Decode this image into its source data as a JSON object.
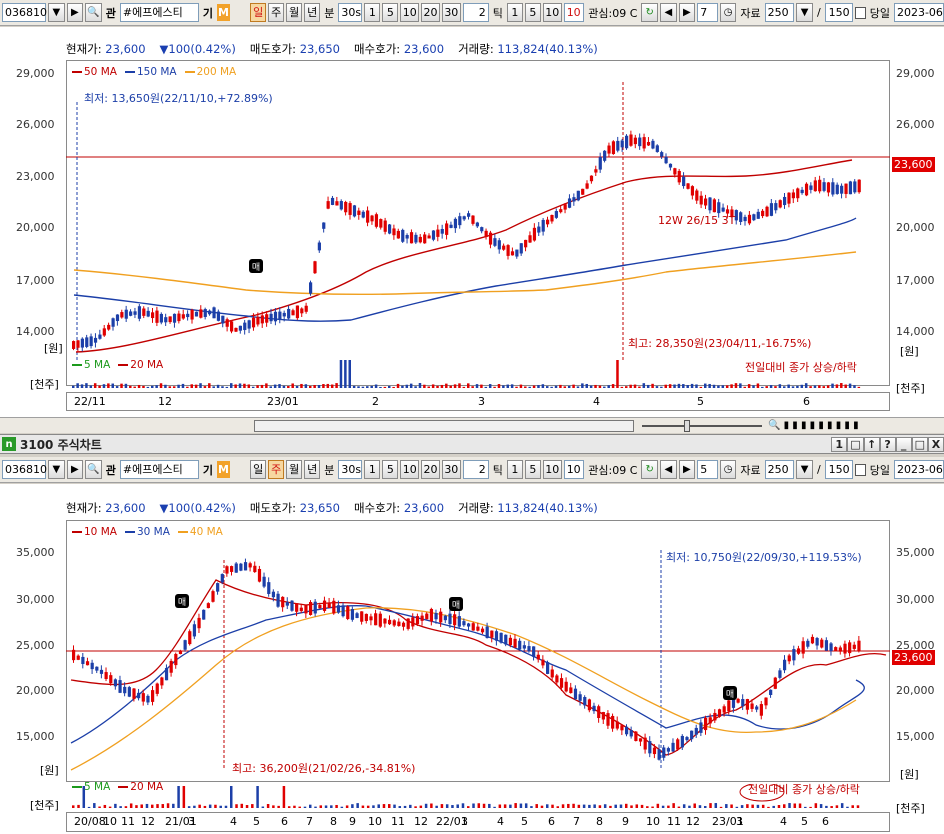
{
  "toolbar1": {
    "code": "036810",
    "name": "#에프에스티",
    "tab_kwan": "관",
    "tab_gi": "기",
    "badge_m": "M",
    "periods": [
      "일",
      "주",
      "월",
      "년",
      "분"
    ],
    "minute_value": "30s",
    "min_buttons": [
      "1",
      "5",
      "10",
      "20",
      "30"
    ],
    "tick_value": "2",
    "tick_label": "틱",
    "tick_buttons": [
      "1",
      "5",
      "10"
    ],
    "tick_input": "10",
    "watch_label": "관심:09 C",
    "count_value": "7",
    "data_label": "자료",
    "data_count": "250",
    "slash": "/",
    "total": "150",
    "today_label": "당일",
    "date": "2023-06"
  },
  "panel1": {
    "info": {
      "current_label": "현재가:",
      "current": "23,600",
      "change": "100(0.42%)",
      "ask_label": "매도호가:",
      "ask": "23,650",
      "bid_label": "매수호가:",
      "bid": "23,600",
      "volume_label": "거래량:",
      "volume": "113,824(40.13%)"
    },
    "legend": [
      {
        "label": "50 MA",
        "color": "#c00000"
      },
      {
        "label": "150 MA",
        "color": "#1c3fa8"
      },
      {
        "label": "200 MA",
        "color": "#f0a020"
      }
    ],
    "low_annot": "최저: 13,650원(22/11/10,+72.89%)",
    "high_annot": "최고: 28,350원(23/04/11,-16.75%)",
    "mid_annot": "12W 26/15 3T",
    "price_tag": "23,600",
    "sell_mark": "매",
    "unit_price": "[원]",
    "unit_vol": "[천주]",
    "vol_legend": [
      {
        "label": "5 MA",
        "color": "#1c9a1c"
      },
      {
        "label": "20 MA",
        "color": "#c00000"
      }
    ],
    "vol_note": "전일대비 종가 상승/하락",
    "y_ticks": [
      "29,000",
      "26,000",
      "23,000",
      "20,000",
      "17,000",
      "14,000"
    ],
    "x_labels": [
      "22/11",
      "12",
      "23/01",
      "2",
      "3",
      "4",
      "5",
      "6"
    ]
  },
  "window2": {
    "title": "3100 주식차트",
    "buttons": [
      "1",
      "□",
      "↑",
      "?",
      "_",
      "□",
      "X"
    ]
  },
  "toolbar2": {
    "code": "036810",
    "name": "#에프에스티",
    "tab_kwan": "관",
    "tab_gi": "기",
    "badge_m": "M",
    "periods": [
      "일",
      "주",
      "월",
      "년",
      "분"
    ],
    "minute_value": "30s",
    "min_buttons": [
      "1",
      "5",
      "10",
      "20",
      "30"
    ],
    "tick_value": "2",
    "tick_label": "틱",
    "tick_buttons": [
      "1",
      "5",
      "10"
    ],
    "tick_input": "10",
    "watch_label": "관심:09 C",
    "count_value": "5",
    "data_label": "자료",
    "data_count": "250",
    "slash": "/",
    "total": "150",
    "today_label": "당일",
    "date": "2023-06"
  },
  "panel2": {
    "info": {
      "current_label": "현재가:",
      "current": "23,600",
      "change": "100(0.42%)",
      "ask_label": "매도호가:",
      "ask": "23,650",
      "bid_label": "매수호가:",
      "bid": "23,600",
      "volume_label": "거래량:",
      "volume": "113,824(40.13%)"
    },
    "legend": [
      {
        "label": "10 MA",
        "color": "#c00000"
      },
      {
        "label": "30 MA",
        "color": "#1c3fa8"
      },
      {
        "label": "40 MA",
        "color": "#f0a020"
      }
    ],
    "low_annot": "최저: 10,750원(22/09/30,+119.53%)",
    "high_annot": "최고: 36,200원(21/02/26,-34.81%)",
    "price_tag": "23,600",
    "sell_mark": "매",
    "unit_price": "[원]",
    "unit_vol": "[천주]",
    "vol_legend": [
      {
        "label": "5 MA",
        "color": "#1c9a1c"
      },
      {
        "label": "20 MA",
        "color": "#c00000"
      }
    ],
    "vol_note": "전일대비 종가 상승/하락",
    "y_ticks": [
      "35,000",
      "30,000",
      "25,000",
      "20,000",
      "15,000"
    ],
    "x_labels": [
      "20/08",
      "10",
      "11",
      "12",
      "21/01",
      "3",
      "4",
      "5",
      "6",
      "7",
      "8",
      "9",
      "10",
      "11",
      "12",
      "22/01",
      "3",
      "4",
      "5",
      "6",
      "7",
      "8",
      "9",
      "10",
      "11",
      "12",
      "23/01",
      "3",
      "4",
      "5",
      "6"
    ]
  }
}
